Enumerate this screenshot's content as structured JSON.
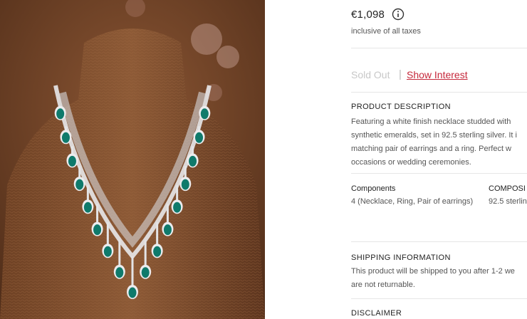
{
  "product": {
    "price": "€1,098",
    "tax_note": "inclusive of all taxes",
    "stock_status": "Sold Out",
    "separator": "|",
    "show_interest_label": "Show Interest"
  },
  "description": {
    "title": "PRODUCT DESCRIPTION",
    "lines": [
      "Featuring a white finish necklace studded with",
      "synthetic emeralds, set in 92.5 sterling silver. It i",
      "matching pair of earrings and a ring. Perfect w",
      "occasions or wedding ceremonies."
    ]
  },
  "specs": {
    "components_label": "Components",
    "components_value": "4 (Necklace, Ring, Pair of earrings)",
    "composition_label": "COMPOSI",
    "composition_value": "92.5 sterlin"
  },
  "shipping": {
    "title": "SHIPPING INFORMATION",
    "lines": [
      "This product will be shipped to you after 1-2 we",
      "are not returnable."
    ]
  },
  "disclaimer": {
    "title": "DISCLAIMER"
  },
  "icons": {
    "info": "info-icon"
  },
  "colors": {
    "accent": "#c6283b",
    "muted": "#c8c8c8",
    "emerald": "#0f7a6b",
    "background": "#6b4026"
  }
}
